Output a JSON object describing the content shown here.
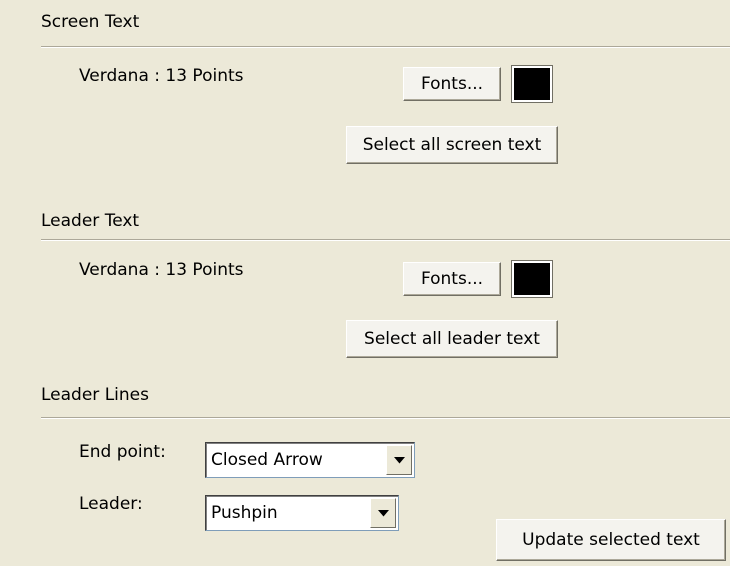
{
  "screen_text": {
    "title": "Screen Text",
    "font_label": "Verdana : 13 Points",
    "fonts_button": "Fonts...",
    "color": "#000000",
    "select_all_button": "Select all screen text"
  },
  "leader_text": {
    "title": "Leader Text",
    "font_label": "Verdana : 13 Points",
    "fonts_button": "Fonts...",
    "color": "#000000",
    "select_all_button": "Select all leader text"
  },
  "leader_lines": {
    "title": "Leader Lines",
    "end_point_label": "End point:",
    "end_point_value": "Closed Arrow",
    "leader_label": "Leader:",
    "leader_value": "Pushpin"
  },
  "update_button": "Update selected text",
  "icons": {
    "dropdown": "chevron-down-icon"
  },
  "colors": {
    "background": "#ece9d8",
    "separator": "#aca899"
  }
}
